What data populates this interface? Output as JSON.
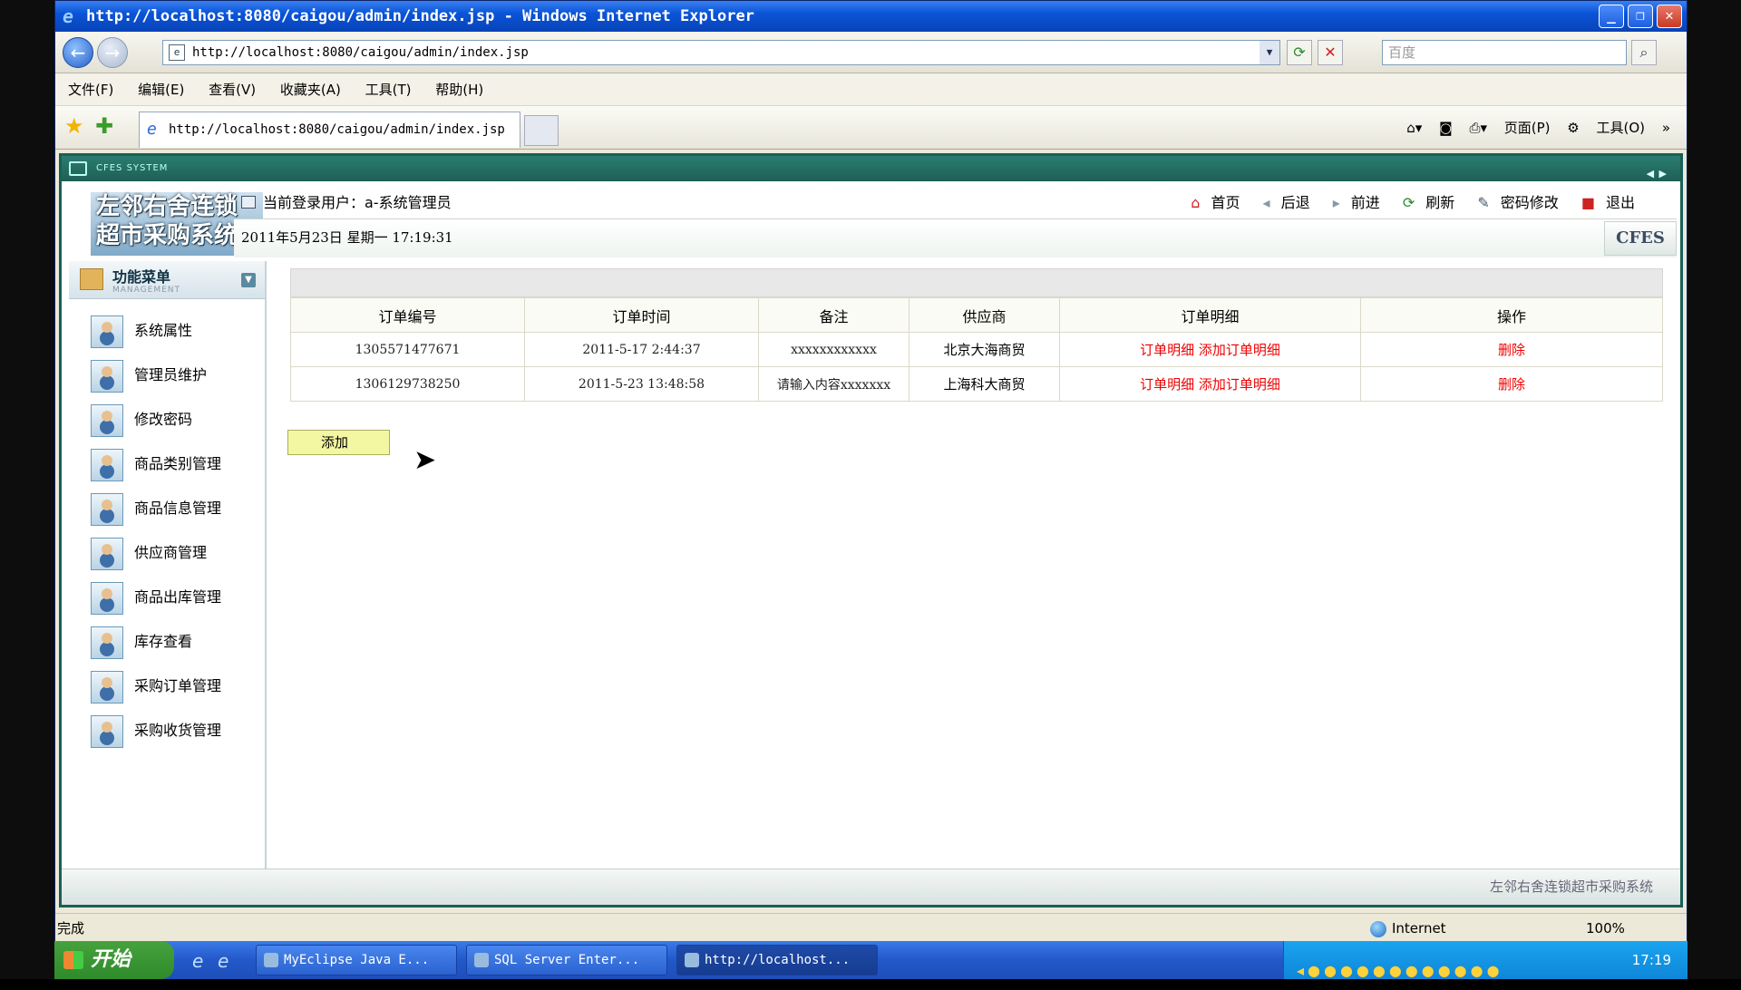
{
  "window": {
    "title": "http://localhost:8080/caigou/admin/index.jsp - Windows Internet Explorer"
  },
  "address": {
    "url": "http://localhost:8080/caigou/admin/index.jsp",
    "search_placeholder": "百度"
  },
  "menubar": {
    "items": [
      "文件(F)",
      "编辑(E)",
      "查看(V)",
      "收藏夹(A)",
      "工具(T)",
      "帮助(H)"
    ]
  },
  "tab": {
    "label": "http://localhost:8080/caigou/admin/index.jsp"
  },
  "commandbar": {
    "page": "页面(P)",
    "tools": "工具(O)"
  },
  "app": {
    "system_label": "CFES SYSTEM",
    "logo_line1": "左邻右舍连锁",
    "logo_line2": "超市采购系统",
    "current_user": "当前登录用户：a-系统管理员",
    "links": {
      "home": "首页",
      "back": "后退",
      "forward": "前进",
      "refresh": "刷新",
      "password": "密码修改",
      "logout": "退出"
    },
    "datetime": "2011年5月23日 星期一 17:19:31",
    "brand": "CFES",
    "sidebar": {
      "title": "功能菜单",
      "subtitle": "MANAGEMENT",
      "items": [
        "系统属性",
        "管理员维护",
        "修改密码",
        "商品类别管理",
        "商品信息管理",
        "供应商管理",
        "商品出库管理",
        "库存查看",
        "采购订单管理",
        "采购收货管理"
      ]
    },
    "table": {
      "headers": [
        "订单编号",
        "订单时间",
        "备注",
        "供应商",
        "订单明细",
        "操作"
      ],
      "rows": [
        {
          "id": "1305571477671",
          "time": "2011-5-17 2:44:37",
          "note": "xxxxxxxxxxxx",
          "supplier": "北京大海商贸",
          "detail": "订单明细",
          "add_detail": "添加订单明细",
          "op": "删除"
        },
        {
          "id": "1306129738250",
          "time": "2011-5-23 13:48:58",
          "note": "请输入内容xxxxxxx",
          "supplier": "上海科大商贸",
          "detail": "订单明细",
          "add_detail": "添加订单明细",
          "op": "删除"
        }
      ]
    },
    "add_button": "添加",
    "footer": "左邻右舍连锁超市采购系统"
  },
  "status": {
    "text": "完成",
    "zone": "Internet",
    "zoom": "100%"
  },
  "taskbar": {
    "start": "开始",
    "tasks": [
      "MyEclipse Java E...",
      "SQL Server Enter...",
      "http://localhost..."
    ],
    "clock": "17:19"
  }
}
